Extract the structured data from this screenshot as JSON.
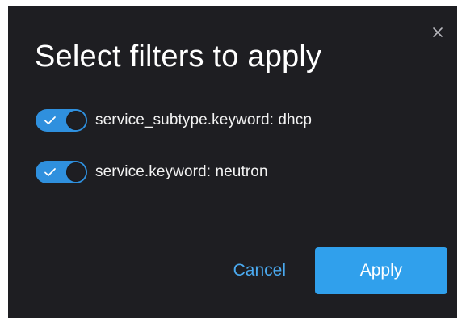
{
  "dialog": {
    "title": "Select filters to apply",
    "close_icon": "close-icon"
  },
  "filters": [
    {
      "label": "service_subtype.keyword: dhcp",
      "enabled": true
    },
    {
      "label": "service.keyword: neutron",
      "enabled": true
    }
  ],
  "actions": {
    "cancel_label": "Cancel",
    "apply_label": "Apply"
  },
  "colors": {
    "dialog_bg": "#1e1e22",
    "accent": "#30a0ec",
    "toggle_on": "#2f90de",
    "link": "#4aa9ef"
  }
}
